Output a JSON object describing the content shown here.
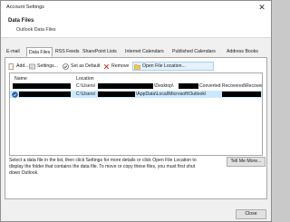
{
  "window": {
    "title": "Account Settings",
    "close_glyph": "✕"
  },
  "header": {
    "title": "Data Files",
    "subtitle": "Outlook Data Files"
  },
  "tabs": [
    {
      "label": "E-mail"
    },
    {
      "label": "Data Files"
    },
    {
      "label": "RSS Feeds"
    },
    {
      "label": "SharePoint Lists"
    },
    {
      "label": "Internet Calendars"
    },
    {
      "label": "Published Calendars"
    },
    {
      "label": "Address Books"
    }
  ],
  "toolbar": {
    "add": "Add...",
    "settings": "Settings...",
    "set_default": "Set as Default",
    "remove": "Remove",
    "open_location": "Open File Location..."
  },
  "list": {
    "col_name": "Name",
    "col_location": "Location",
    "rows": [
      {
        "location_prefix": "C:\\Users\\",
        "location_mid": "\\Desktop\\",
        "location_suffix": "Converted Recovered\\Recovered\\a...",
        "selected": false,
        "default": false
      },
      {
        "location_prefix": "C:\\Users\\",
        "location_mid": "\\AppData\\Local\\Microsoft\\Outlook\\",
        "location_suffix": "",
        "selected": true,
        "default": true
      }
    ]
  },
  "info_text": "Select a data file in the list, then click Settings for more details or click Open File Location to display the folder that contains the data file. To move or copy these files, you must first shut down Outlook.",
  "buttons": {
    "tell_me_more": "Tell Me More...",
    "close": "Close"
  },
  "colors": {
    "selection": "#cce8ff",
    "accent": "#1e6bb8",
    "default_badge": "#1f5fa8"
  }
}
